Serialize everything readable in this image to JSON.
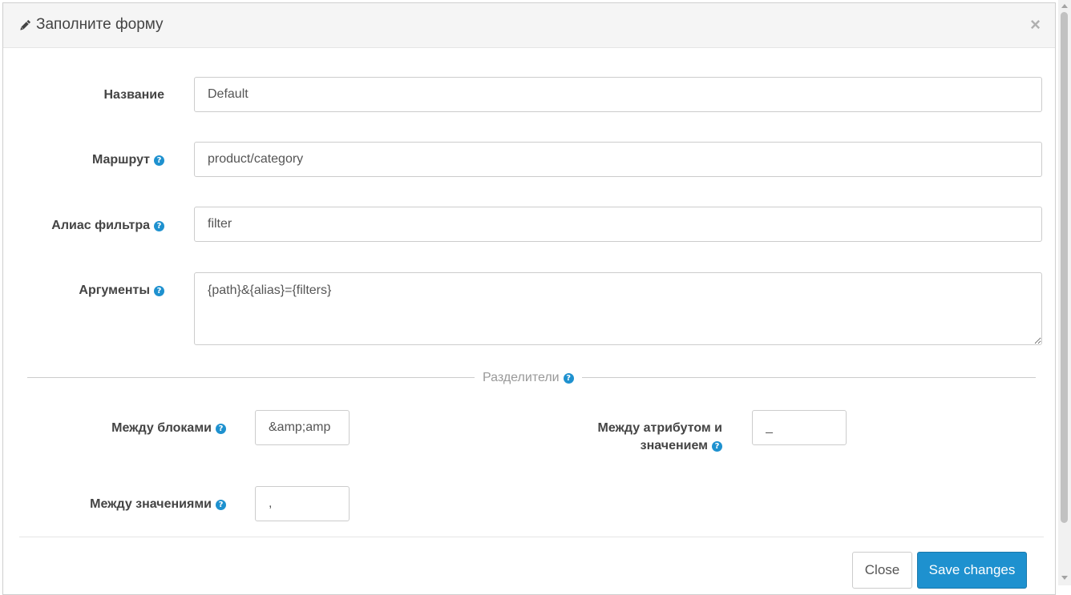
{
  "modal": {
    "title": "Заполните форму",
    "close_symbol": "×",
    "icon": "pencil-icon"
  },
  "form": {
    "name": {
      "label": "Название",
      "value": "Default"
    },
    "route": {
      "label": "Маршрут",
      "value": "product/category"
    },
    "filter_alias": {
      "label": "Алиас фильтра",
      "value": "filter"
    },
    "arguments": {
      "label": "Аргументы",
      "value": "{path}&{alias}={filters}"
    }
  },
  "separators": {
    "heading": "Разделители",
    "between_blocks": {
      "label": "Между блоками",
      "value": "&amp;amp"
    },
    "between_attr_value": {
      "label_line1": "Между атрибутом и",
      "label_line2": "значением",
      "value": "_"
    },
    "between_values": {
      "label": "Между значениями",
      "value": ","
    }
  },
  "help_symbol": "?",
  "footer": {
    "close_label": "Close",
    "save_label": "Save changes"
  },
  "colors": {
    "primary": "#1e91cf",
    "header_bg": "#f5f5f5",
    "help_icon": "#1e91cf"
  }
}
